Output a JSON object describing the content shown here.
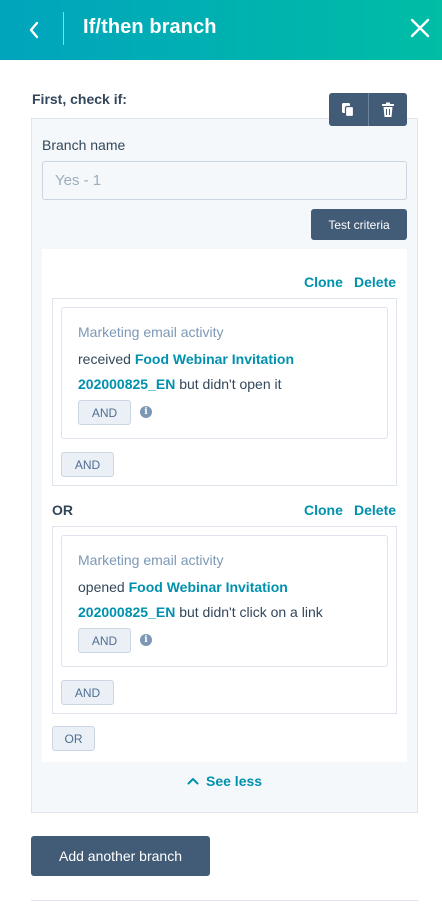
{
  "header": {
    "title": "If/then branch"
  },
  "section_label": "First, check if:",
  "branch": {
    "name_label": "Branch name",
    "name_placeholder": "Yes - 1",
    "test_label": "Test criteria"
  },
  "groups": [
    {
      "clone_label": "Clone",
      "delete_label": "Delete",
      "criteria": {
        "category": "Marketing email activity",
        "verb": "received ",
        "email_part1": "Food Webinar Invitation",
        "email_part2": "202000825_EN",
        "suffix": " but didn't open it",
        "and_label": "AND"
      },
      "and_label": "AND"
    },
    {
      "connector": "OR",
      "clone_label": "Clone",
      "delete_label": "Delete",
      "criteria": {
        "category": "Marketing email activity",
        "verb": "opened ",
        "email_part1": "Food Webinar Invitation",
        "email_part2": "202000825_EN",
        "suffix": " but didn't click on a link",
        "and_label": "AND"
      },
      "and_label": "AND"
    }
  ],
  "or_button_label": "OR",
  "see_less_label": "See less",
  "add_branch_label": "Add another branch",
  "icons": {
    "back": "chevron-left-icon",
    "close": "close-icon",
    "clone": "copy-icon",
    "delete": "trash-icon",
    "info": "info-icon",
    "collapse": "chevron-up-icon"
  },
  "colors": {
    "header_start": "#00a4bd",
    "header_end": "#00bda5",
    "link": "#0091ae",
    "dark_button": "#425b76",
    "text": "#33475b",
    "muted": "#7c98b6"
  }
}
